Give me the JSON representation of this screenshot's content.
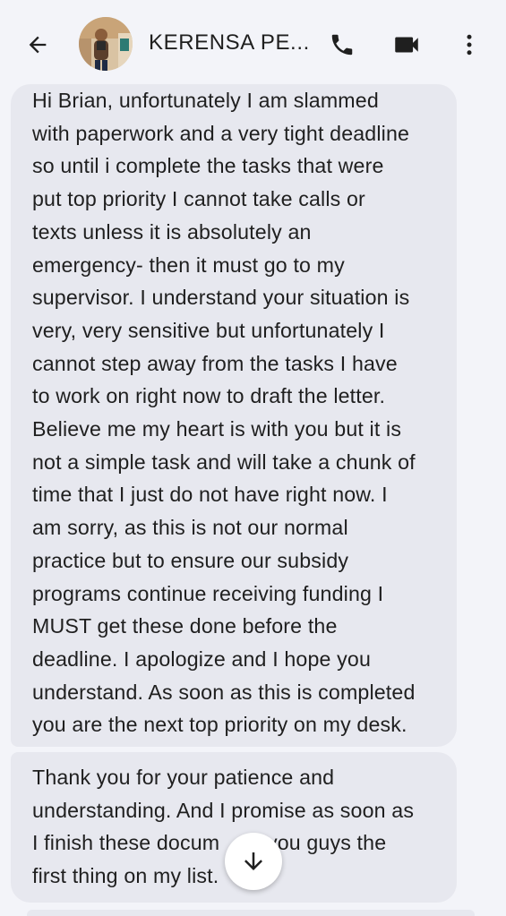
{
  "header": {
    "contact_name": "KERENSA PE...",
    "back_icon": "arrow-back-icon",
    "call_icon": "phone-icon",
    "video_icon": "video-camera-icon",
    "more_icon": "more-vertical-icon",
    "avatar_icon": "contact-photo"
  },
  "messages": [
    {
      "lines": [
        "Hi Brian, unfortunately I am slammed",
        "with paperwork and a very tight deadline",
        "so until i complete the tasks that were",
        "put top priority I cannot take calls or",
        "texts unless it is absolutely an",
        "emergency- then it must go to my",
        "supervisor. I understand your situation is",
        "very, very sensitive but unfortunately I",
        "cannot step away from the tasks I have",
        "to work on right now to draft the letter.",
        "Believe me my heart is with you but it is",
        "not a simple task and will take a chunk of",
        "time that I just do not have right now. I",
        "am sorry, as this is not our normal",
        "practice but to ensure our subsidy",
        "programs continue receiving funding I",
        "MUST get these done before the",
        "deadline. I apologize and I hope you",
        "understand. As soon as this is completed",
        "you are the next top priority on my desk."
      ]
    },
    {
      "lines": [
        "Thank you for your patience and",
        "understanding. And I promise as soon as",
        "I finish these docum        you guys the",
        "first thing on my list."
      ]
    }
  ],
  "scroll_button": {
    "icon": "arrow-down-icon"
  },
  "colors": {
    "background": "#f3f4f9",
    "bubble": "#e7e8ef",
    "text": "#1f1f1f",
    "icon": "#1f1f1f"
  }
}
